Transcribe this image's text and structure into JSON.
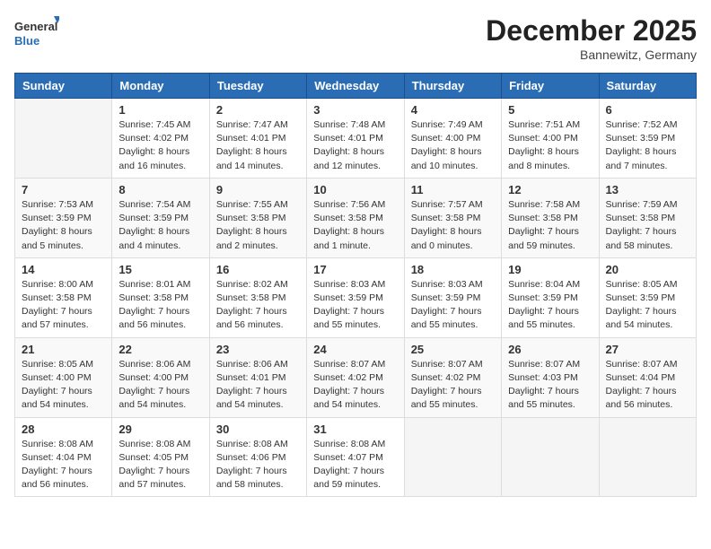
{
  "header": {
    "logo_line1": "General",
    "logo_line2": "Blue",
    "month_title": "December 2025",
    "subtitle": "Bannewitz, Germany"
  },
  "days_of_week": [
    "Sunday",
    "Monday",
    "Tuesday",
    "Wednesday",
    "Thursday",
    "Friday",
    "Saturday"
  ],
  "weeks": [
    [
      {
        "day": "",
        "info": ""
      },
      {
        "day": "1",
        "info": "Sunrise: 7:45 AM\nSunset: 4:02 PM\nDaylight: 8 hours\nand 16 minutes."
      },
      {
        "day": "2",
        "info": "Sunrise: 7:47 AM\nSunset: 4:01 PM\nDaylight: 8 hours\nand 14 minutes."
      },
      {
        "day": "3",
        "info": "Sunrise: 7:48 AM\nSunset: 4:01 PM\nDaylight: 8 hours\nand 12 minutes."
      },
      {
        "day": "4",
        "info": "Sunrise: 7:49 AM\nSunset: 4:00 PM\nDaylight: 8 hours\nand 10 minutes."
      },
      {
        "day": "5",
        "info": "Sunrise: 7:51 AM\nSunset: 4:00 PM\nDaylight: 8 hours\nand 8 minutes."
      },
      {
        "day": "6",
        "info": "Sunrise: 7:52 AM\nSunset: 3:59 PM\nDaylight: 8 hours\nand 7 minutes."
      }
    ],
    [
      {
        "day": "7",
        "info": "Sunrise: 7:53 AM\nSunset: 3:59 PM\nDaylight: 8 hours\nand 5 minutes."
      },
      {
        "day": "8",
        "info": "Sunrise: 7:54 AM\nSunset: 3:59 PM\nDaylight: 8 hours\nand 4 minutes."
      },
      {
        "day": "9",
        "info": "Sunrise: 7:55 AM\nSunset: 3:58 PM\nDaylight: 8 hours\nand 2 minutes."
      },
      {
        "day": "10",
        "info": "Sunrise: 7:56 AM\nSunset: 3:58 PM\nDaylight: 8 hours\nand 1 minute."
      },
      {
        "day": "11",
        "info": "Sunrise: 7:57 AM\nSunset: 3:58 PM\nDaylight: 8 hours\nand 0 minutes."
      },
      {
        "day": "12",
        "info": "Sunrise: 7:58 AM\nSunset: 3:58 PM\nDaylight: 7 hours\nand 59 minutes."
      },
      {
        "day": "13",
        "info": "Sunrise: 7:59 AM\nSunset: 3:58 PM\nDaylight: 7 hours\nand 58 minutes."
      }
    ],
    [
      {
        "day": "14",
        "info": "Sunrise: 8:00 AM\nSunset: 3:58 PM\nDaylight: 7 hours\nand 57 minutes."
      },
      {
        "day": "15",
        "info": "Sunrise: 8:01 AM\nSunset: 3:58 PM\nDaylight: 7 hours\nand 56 minutes."
      },
      {
        "day": "16",
        "info": "Sunrise: 8:02 AM\nSunset: 3:58 PM\nDaylight: 7 hours\nand 56 minutes."
      },
      {
        "day": "17",
        "info": "Sunrise: 8:03 AM\nSunset: 3:59 PM\nDaylight: 7 hours\nand 55 minutes."
      },
      {
        "day": "18",
        "info": "Sunrise: 8:03 AM\nSunset: 3:59 PM\nDaylight: 7 hours\nand 55 minutes."
      },
      {
        "day": "19",
        "info": "Sunrise: 8:04 AM\nSunset: 3:59 PM\nDaylight: 7 hours\nand 55 minutes."
      },
      {
        "day": "20",
        "info": "Sunrise: 8:05 AM\nSunset: 3:59 PM\nDaylight: 7 hours\nand 54 minutes."
      }
    ],
    [
      {
        "day": "21",
        "info": "Sunrise: 8:05 AM\nSunset: 4:00 PM\nDaylight: 7 hours\nand 54 minutes."
      },
      {
        "day": "22",
        "info": "Sunrise: 8:06 AM\nSunset: 4:00 PM\nDaylight: 7 hours\nand 54 minutes."
      },
      {
        "day": "23",
        "info": "Sunrise: 8:06 AM\nSunset: 4:01 PM\nDaylight: 7 hours\nand 54 minutes."
      },
      {
        "day": "24",
        "info": "Sunrise: 8:07 AM\nSunset: 4:02 PM\nDaylight: 7 hours\nand 54 minutes."
      },
      {
        "day": "25",
        "info": "Sunrise: 8:07 AM\nSunset: 4:02 PM\nDaylight: 7 hours\nand 55 minutes."
      },
      {
        "day": "26",
        "info": "Sunrise: 8:07 AM\nSunset: 4:03 PM\nDaylight: 7 hours\nand 55 minutes."
      },
      {
        "day": "27",
        "info": "Sunrise: 8:07 AM\nSunset: 4:04 PM\nDaylight: 7 hours\nand 56 minutes."
      }
    ],
    [
      {
        "day": "28",
        "info": "Sunrise: 8:08 AM\nSunset: 4:04 PM\nDaylight: 7 hours\nand 56 minutes."
      },
      {
        "day": "29",
        "info": "Sunrise: 8:08 AM\nSunset: 4:05 PM\nDaylight: 7 hours\nand 57 minutes."
      },
      {
        "day": "30",
        "info": "Sunrise: 8:08 AM\nSunset: 4:06 PM\nDaylight: 7 hours\nand 58 minutes."
      },
      {
        "day": "31",
        "info": "Sunrise: 8:08 AM\nSunset: 4:07 PM\nDaylight: 7 hours\nand 59 minutes."
      },
      {
        "day": "",
        "info": ""
      },
      {
        "day": "",
        "info": ""
      },
      {
        "day": "",
        "info": ""
      }
    ]
  ]
}
